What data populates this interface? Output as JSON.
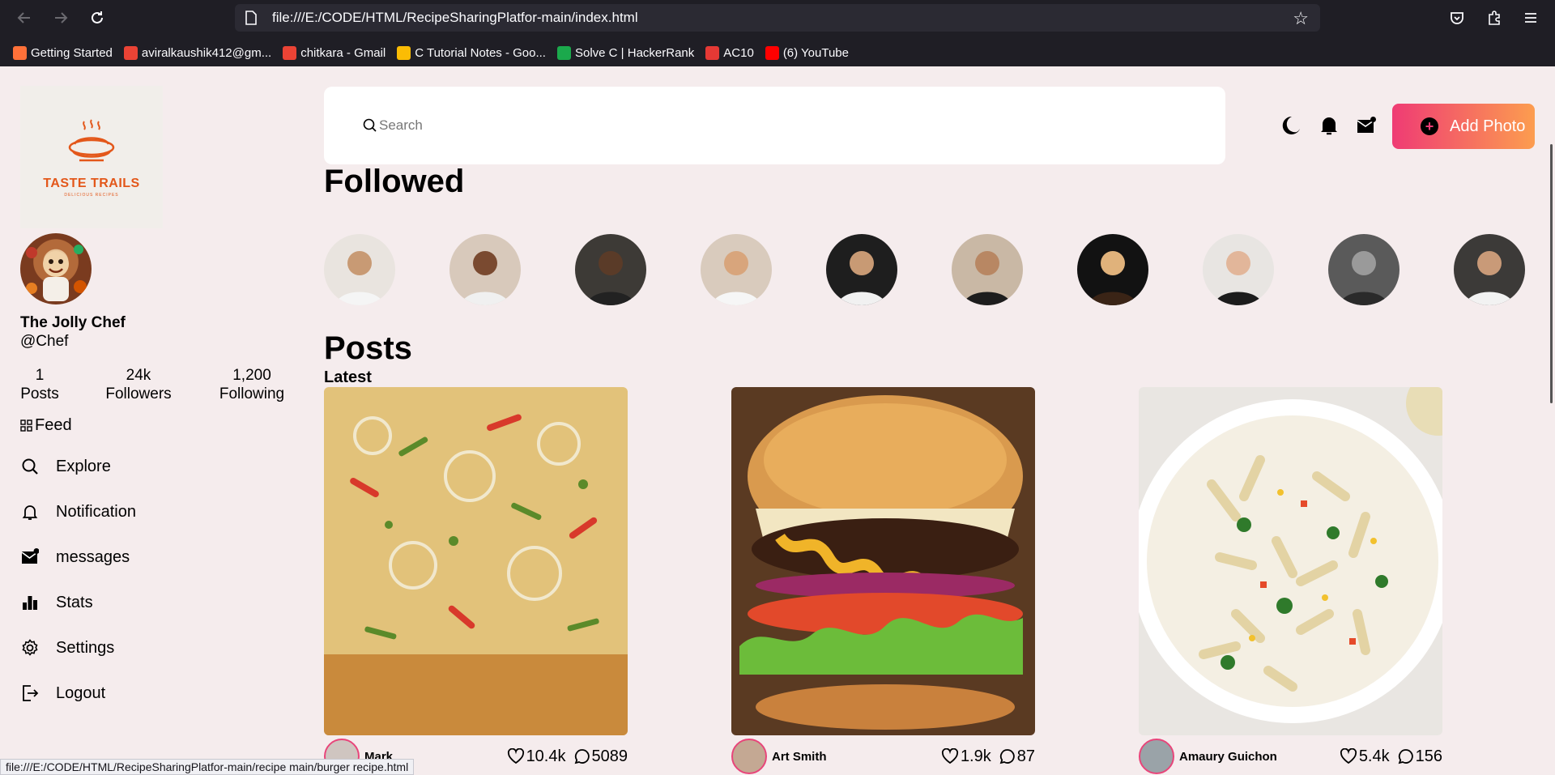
{
  "browser": {
    "url": "file:///E:/CODE/HTML/RecipeSharingPlatfor-main/index.html",
    "bookmarks": [
      {
        "label": "Getting Started",
        "icon": "firefox-icon",
        "color": "#ff7139"
      },
      {
        "label": "aviralkaushik412@gm...",
        "icon": "gmail-icon",
        "color": "#ea4335"
      },
      {
        "label": "chitkara - Gmail",
        "icon": "gmail-icon",
        "color": "#ea4335"
      },
      {
        "label": "C Tutorial Notes - Goo...",
        "icon": "google-drive-icon",
        "color": "#fbbc04"
      },
      {
        "label": "Solve C | HackerRank",
        "icon": "hackerrank-icon",
        "color": "#1ba94c"
      },
      {
        "label": "AC10",
        "icon": "ac10-icon",
        "color": "#e53935"
      },
      {
        "label": "(6) YouTube",
        "icon": "youtube-icon",
        "color": "#ff0000"
      }
    ],
    "status_url": "file:///E:/CODE/HTML/RecipeSharingPlatfor-main/recipe main/burger recipe.html"
  },
  "brand": {
    "logo_title": "TASTE TRAILS",
    "logo_subtitle": "DELICIOUS RECIPES",
    "accent": "#e3571a"
  },
  "profile": {
    "name": "The Jolly Chef",
    "handle": "@Chef",
    "stats": [
      {
        "value": "1",
        "label": "Posts"
      },
      {
        "value": "24k",
        "label": "Followers"
      },
      {
        "value": "1,200",
        "label": "Following"
      }
    ]
  },
  "menu": [
    {
      "label": "Feed",
      "icon": "grid-icon"
    },
    {
      "label": "Explore",
      "icon": "search-icon"
    },
    {
      "label": "Notification",
      "icon": "bell-icon"
    },
    {
      "label": "messages",
      "icon": "mail-icon"
    },
    {
      "label": "Stats",
      "icon": "bar-chart-icon"
    },
    {
      "label": "Settings",
      "icon": "gear-icon"
    },
    {
      "label": "Logout",
      "icon": "logout-icon"
    }
  ],
  "search": {
    "placeholder": "Search"
  },
  "actions": {
    "add_photo": "Add Photo"
  },
  "followed": {
    "title": "Followed",
    "count": 10
  },
  "posts": {
    "title": "Posts",
    "subtitle": "Latest",
    "items": [
      {
        "author": "Mark",
        "likes": "10.4k",
        "comments": "5089",
        "image": "pizza"
      },
      {
        "author": "Art Smith",
        "likes": "1.9k",
        "comments": "87",
        "image": "burger"
      },
      {
        "author": "Amaury Guichon",
        "likes": "5.4k",
        "comments": "156",
        "image": "pasta"
      }
    ]
  },
  "colors": {
    "background": "#f5eced",
    "add_photo_gradient_start": "#ef3b74",
    "add_photo_gradient_end": "#fc9d4f"
  }
}
